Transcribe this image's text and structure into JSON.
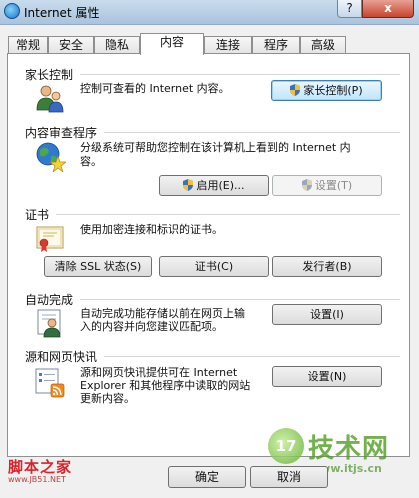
{
  "window": {
    "title": "Internet 属性",
    "help_label": "?",
    "close_label": "x"
  },
  "tabs": [
    {
      "label": "常规"
    },
    {
      "label": "安全"
    },
    {
      "label": "隐私"
    },
    {
      "label": "内容"
    },
    {
      "label": "连接"
    },
    {
      "label": "程序"
    },
    {
      "label": "高级"
    }
  ],
  "active_tab": "内容",
  "sections": {
    "parental": {
      "title": "家长控制",
      "desc": "控制可查看的 Internet 内容。",
      "button": "家长控制(P)",
      "icon": "parental-users-icon"
    },
    "advisor": {
      "title": "内容审查程序",
      "desc_line1": "分级系统可帮助您控制在该计算机上看到的 Internet 内",
      "desc_line2": "容。",
      "enable_button": "启用(E)...",
      "settings_button": "设置(T)",
      "icon": "globe-star-icon"
    },
    "certificates": {
      "title": "证书",
      "desc": "使用加密连接和标识的证书。",
      "clear_ssl_button": "清除 SSL 状态(S)",
      "certs_button": "证书(C)",
      "publishers_button": "发行者(B)",
      "icon": "certificate-icon"
    },
    "autocomplete": {
      "title": "自动完成",
      "desc_line1": "自动完成功能存储以前在网页上输",
      "desc_line2": "入的内容并向您建议匹配项。",
      "settings_button": "设置(I)",
      "icon": "autocomplete-user-icon"
    },
    "feeds": {
      "title": "源和网页快讯",
      "desc_line1": "源和网页快讯提供可在 Internet",
      "desc_line2": "Explorer 和其他程序中读取的网站",
      "desc_line3": "更新内容。",
      "settings_button": "设置(N)",
      "icon": "feed-list-icon"
    }
  },
  "footer": {
    "ok_label": "确定",
    "cancel_label": "取消"
  },
  "watermarks": {
    "left_main": "脚本之家",
    "left_sub": "www.JB51.NET",
    "right_logo": "17",
    "right_text": "技术网",
    "right_url": "www.itjs.cn"
  }
}
